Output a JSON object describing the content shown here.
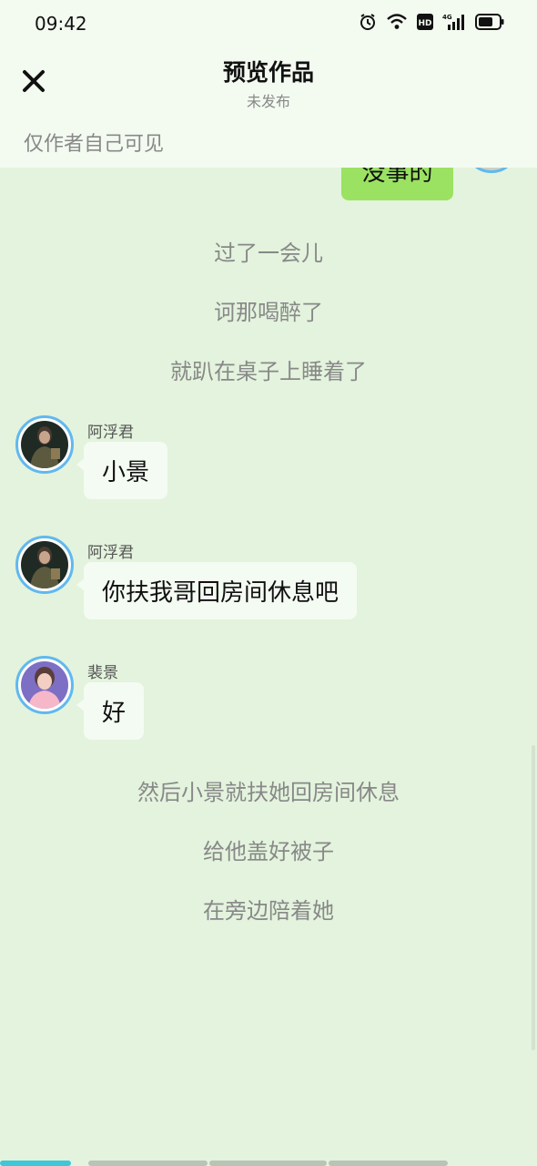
{
  "status_bar": {
    "time": "09:42",
    "icons": [
      "alarm-icon",
      "wifi-icon",
      "hd-icon",
      "signal-4g-icon",
      "battery-icon"
    ],
    "hd_label": "HD",
    "network_label": "4G"
  },
  "header": {
    "title": "预览作品",
    "subtitle": "未发布",
    "visibility_note": "仅作者自己可见",
    "close_icon": "close-icon"
  },
  "chat": {
    "partial_right_message": "没事的",
    "narrations_top": [
      "过了一会儿",
      "诃那喝醉了",
      "就趴在桌子上睡着了"
    ],
    "messages": [
      {
        "sender": "阿浮君",
        "text": "小景"
      },
      {
        "sender": "阿浮君",
        "text": "你扶我哥回房间休息吧"
      },
      {
        "sender": "裴景",
        "text": "好"
      }
    ],
    "narrations_bottom": [
      "然后小景就扶她回房间休息",
      "给他盖好被子",
      "在旁边陪着她"
    ]
  },
  "colors": {
    "background": "#e3f3dd",
    "header_bg": "#f3fbf1",
    "right_bubble": "#9be262",
    "left_bubble": "#f4fbf2",
    "avatar_ring": "#61b8ee",
    "progress_active": "#3ec6d9",
    "progress_inactive": "#b9c4b7"
  },
  "progress": {
    "segments": 4,
    "active_segments": 1
  }
}
